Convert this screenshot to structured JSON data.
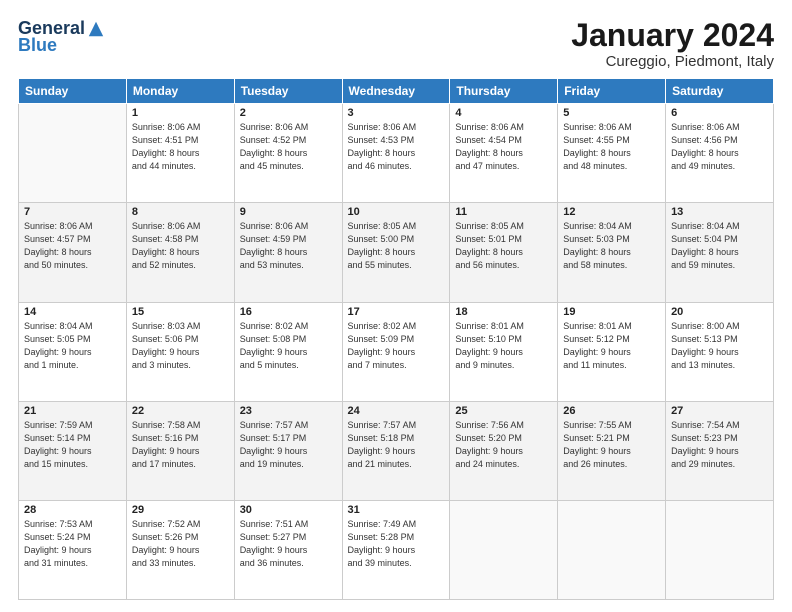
{
  "header": {
    "logo_general": "General",
    "logo_blue": "Blue",
    "month": "January 2024",
    "location": "Cureggio, Piedmont, Italy"
  },
  "weekdays": [
    "Sunday",
    "Monday",
    "Tuesday",
    "Wednesday",
    "Thursday",
    "Friday",
    "Saturday"
  ],
  "weeks": [
    [
      {
        "day": "",
        "info": ""
      },
      {
        "day": "1",
        "info": "Sunrise: 8:06 AM\nSunset: 4:51 PM\nDaylight: 8 hours\nand 44 minutes."
      },
      {
        "day": "2",
        "info": "Sunrise: 8:06 AM\nSunset: 4:52 PM\nDaylight: 8 hours\nand 45 minutes."
      },
      {
        "day": "3",
        "info": "Sunrise: 8:06 AM\nSunset: 4:53 PM\nDaylight: 8 hours\nand 46 minutes."
      },
      {
        "day": "4",
        "info": "Sunrise: 8:06 AM\nSunset: 4:54 PM\nDaylight: 8 hours\nand 47 minutes."
      },
      {
        "day": "5",
        "info": "Sunrise: 8:06 AM\nSunset: 4:55 PM\nDaylight: 8 hours\nand 48 minutes."
      },
      {
        "day": "6",
        "info": "Sunrise: 8:06 AM\nSunset: 4:56 PM\nDaylight: 8 hours\nand 49 minutes."
      }
    ],
    [
      {
        "day": "7",
        "info": "Sunrise: 8:06 AM\nSunset: 4:57 PM\nDaylight: 8 hours\nand 50 minutes."
      },
      {
        "day": "8",
        "info": "Sunrise: 8:06 AM\nSunset: 4:58 PM\nDaylight: 8 hours\nand 52 minutes."
      },
      {
        "day": "9",
        "info": "Sunrise: 8:06 AM\nSunset: 4:59 PM\nDaylight: 8 hours\nand 53 minutes."
      },
      {
        "day": "10",
        "info": "Sunrise: 8:05 AM\nSunset: 5:00 PM\nDaylight: 8 hours\nand 55 minutes."
      },
      {
        "day": "11",
        "info": "Sunrise: 8:05 AM\nSunset: 5:01 PM\nDaylight: 8 hours\nand 56 minutes."
      },
      {
        "day": "12",
        "info": "Sunrise: 8:04 AM\nSunset: 5:03 PM\nDaylight: 8 hours\nand 58 minutes."
      },
      {
        "day": "13",
        "info": "Sunrise: 8:04 AM\nSunset: 5:04 PM\nDaylight: 8 hours\nand 59 minutes."
      }
    ],
    [
      {
        "day": "14",
        "info": "Sunrise: 8:04 AM\nSunset: 5:05 PM\nDaylight: 9 hours\nand 1 minute."
      },
      {
        "day": "15",
        "info": "Sunrise: 8:03 AM\nSunset: 5:06 PM\nDaylight: 9 hours\nand 3 minutes."
      },
      {
        "day": "16",
        "info": "Sunrise: 8:02 AM\nSunset: 5:08 PM\nDaylight: 9 hours\nand 5 minutes."
      },
      {
        "day": "17",
        "info": "Sunrise: 8:02 AM\nSunset: 5:09 PM\nDaylight: 9 hours\nand 7 minutes."
      },
      {
        "day": "18",
        "info": "Sunrise: 8:01 AM\nSunset: 5:10 PM\nDaylight: 9 hours\nand 9 minutes."
      },
      {
        "day": "19",
        "info": "Sunrise: 8:01 AM\nSunset: 5:12 PM\nDaylight: 9 hours\nand 11 minutes."
      },
      {
        "day": "20",
        "info": "Sunrise: 8:00 AM\nSunset: 5:13 PM\nDaylight: 9 hours\nand 13 minutes."
      }
    ],
    [
      {
        "day": "21",
        "info": "Sunrise: 7:59 AM\nSunset: 5:14 PM\nDaylight: 9 hours\nand 15 minutes."
      },
      {
        "day": "22",
        "info": "Sunrise: 7:58 AM\nSunset: 5:16 PM\nDaylight: 9 hours\nand 17 minutes."
      },
      {
        "day": "23",
        "info": "Sunrise: 7:57 AM\nSunset: 5:17 PM\nDaylight: 9 hours\nand 19 minutes."
      },
      {
        "day": "24",
        "info": "Sunrise: 7:57 AM\nSunset: 5:18 PM\nDaylight: 9 hours\nand 21 minutes."
      },
      {
        "day": "25",
        "info": "Sunrise: 7:56 AM\nSunset: 5:20 PM\nDaylight: 9 hours\nand 24 minutes."
      },
      {
        "day": "26",
        "info": "Sunrise: 7:55 AM\nSunset: 5:21 PM\nDaylight: 9 hours\nand 26 minutes."
      },
      {
        "day": "27",
        "info": "Sunrise: 7:54 AM\nSunset: 5:23 PM\nDaylight: 9 hours\nand 29 minutes."
      }
    ],
    [
      {
        "day": "28",
        "info": "Sunrise: 7:53 AM\nSunset: 5:24 PM\nDaylight: 9 hours\nand 31 minutes."
      },
      {
        "day": "29",
        "info": "Sunrise: 7:52 AM\nSunset: 5:26 PM\nDaylight: 9 hours\nand 33 minutes."
      },
      {
        "day": "30",
        "info": "Sunrise: 7:51 AM\nSunset: 5:27 PM\nDaylight: 9 hours\nand 36 minutes."
      },
      {
        "day": "31",
        "info": "Sunrise: 7:49 AM\nSunset: 5:28 PM\nDaylight: 9 hours\nand 39 minutes."
      },
      {
        "day": "",
        "info": ""
      },
      {
        "day": "",
        "info": ""
      },
      {
        "day": "",
        "info": ""
      }
    ]
  ]
}
